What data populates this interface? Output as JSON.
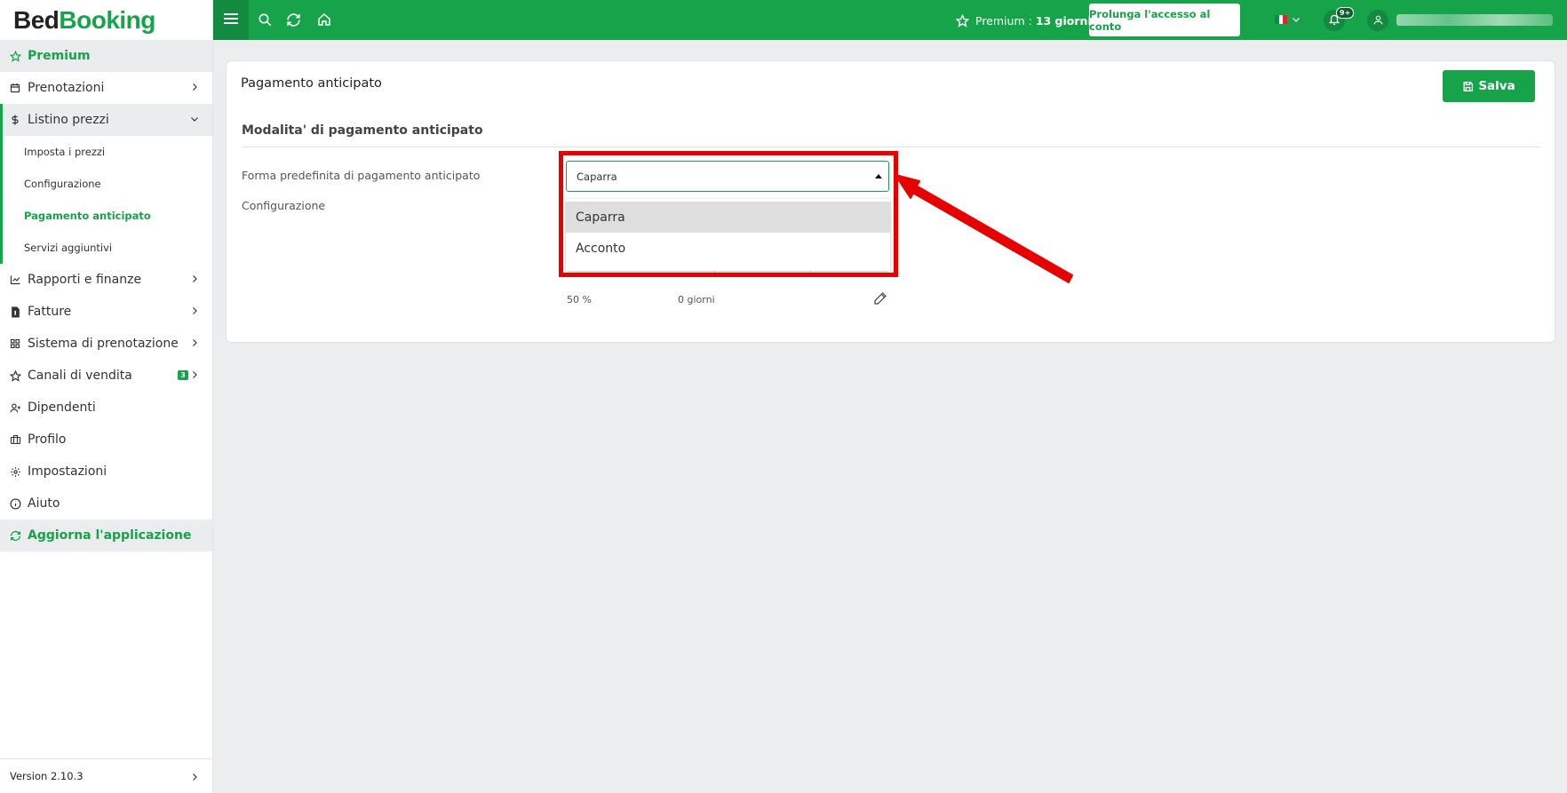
{
  "brand": {
    "part1": "Bed",
    "part2": "Booking"
  },
  "sidebar": {
    "items": [
      {
        "label": "Premium",
        "icon": "star-icon"
      },
      {
        "label": "Prenotazioni",
        "icon": "calendar-icon"
      },
      {
        "label": "Listino prezzi",
        "icon": "dollar-icon"
      },
      {
        "label": "Rapporti e finanze",
        "icon": "chart-icon"
      },
      {
        "label": "Fatture",
        "icon": "invoice-icon"
      },
      {
        "label": "Sistema di prenotazione",
        "icon": "grid-icon"
      },
      {
        "label": "Canali di vendita",
        "icon": "star-icon",
        "badge": "3"
      },
      {
        "label": "Dipendenti",
        "icon": "user-plus-icon"
      },
      {
        "label": "Profilo",
        "icon": "briefcase-icon"
      },
      {
        "label": "Impostazioni",
        "icon": "gear-icon"
      },
      {
        "label": "Aiuto",
        "icon": "info-icon"
      },
      {
        "label": "Aggiorna l'applicazione",
        "icon": "refresh-icon"
      }
    ],
    "subitems": [
      {
        "label": "Imposta i prezzi"
      },
      {
        "label": "Configurazione"
      },
      {
        "label": "Pagamento anticipato"
      },
      {
        "label": "Servizi aggiuntivi"
      }
    ],
    "version": "Version 2.10.3"
  },
  "topbar": {
    "premium_label": "Premium :",
    "premium_days": "13 giorni",
    "extend_button": "Prolunga l'accesso al conto",
    "notifications_count": "9+"
  },
  "main": {
    "title": "Pagamento anticipato",
    "save_button": "Salva",
    "section_title": "Modalita' di pagamento anticipato",
    "default_form_label": "Forma predefinita di pagamento anticipato",
    "config_label": "Configurazione",
    "select_value": "Caparra",
    "options": [
      "Caparra",
      "Acconto"
    ],
    "row_percent": "50 %",
    "row_days": "0 giorni"
  },
  "colors": {
    "brand_green": "#16a34a",
    "dark_green": "#128a3f",
    "annotation_red": "#e60000",
    "background": "#ebedef"
  }
}
